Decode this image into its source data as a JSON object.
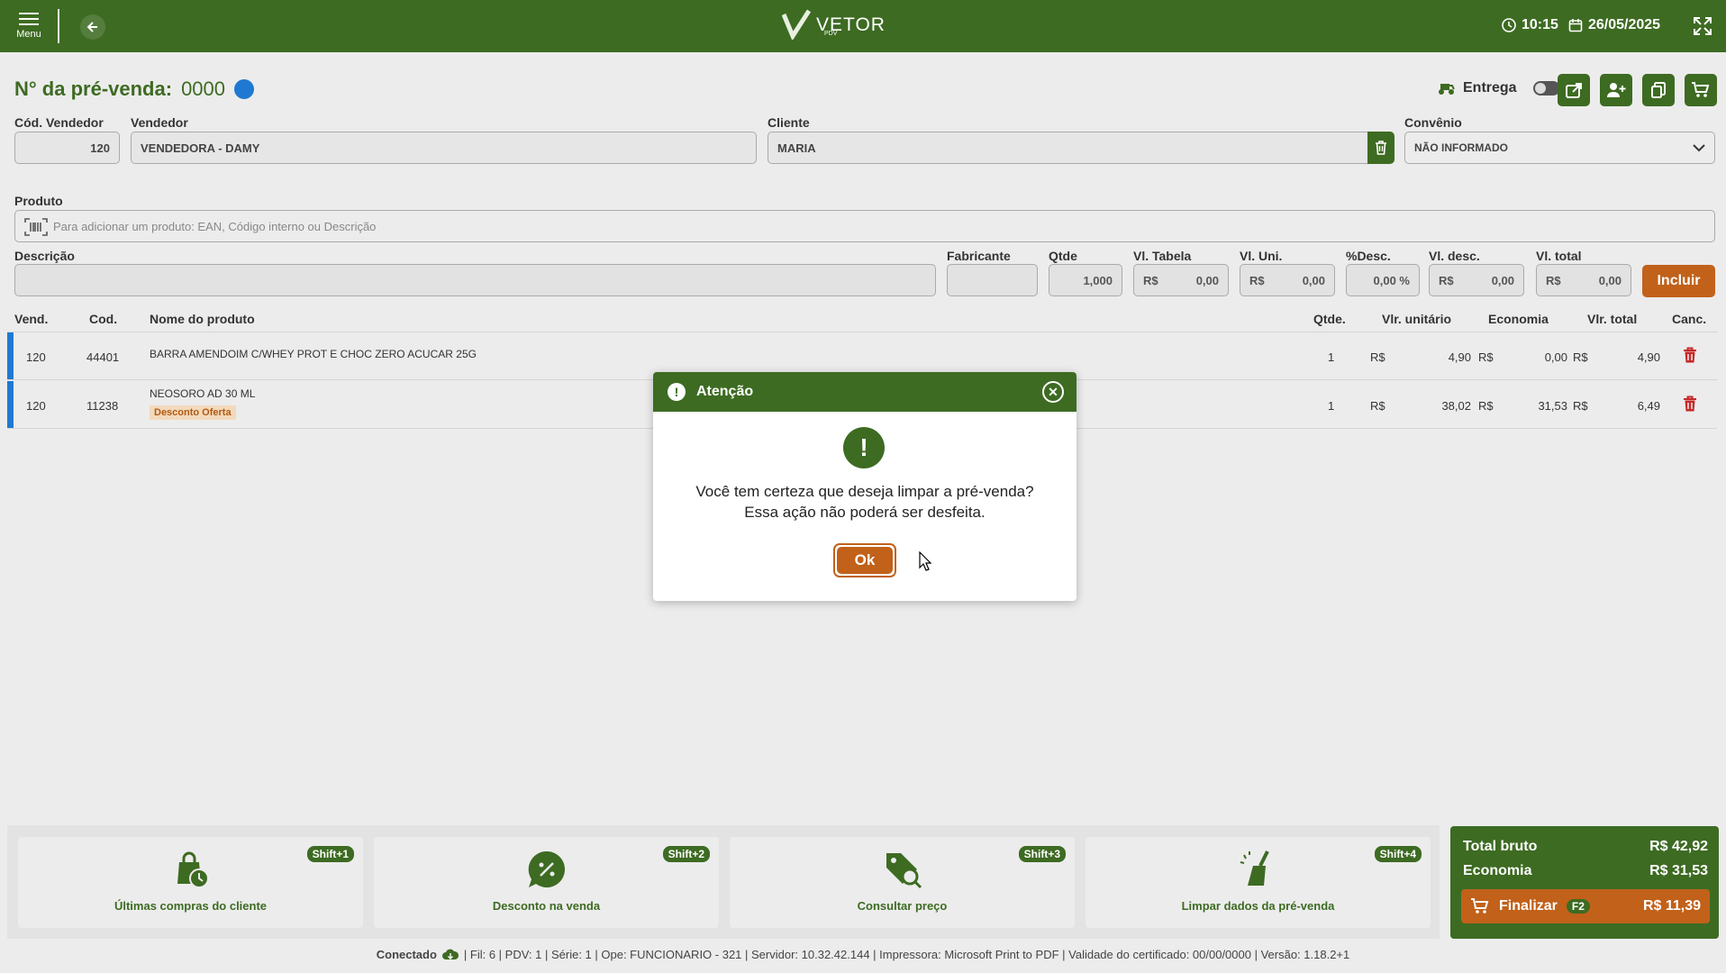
{
  "topbar": {
    "menu_label": "Menu",
    "logo_name": "VETOR",
    "logo_sub": "PDV",
    "time": "10:15",
    "date": "26/05/2025"
  },
  "header": {
    "title_label": "N° da pré-venda:",
    "title_number": "0000",
    "entrega_label": "Entrega",
    "cod_vendedor_label": "Cód. Vendedor",
    "cod_vendedor_value": "120",
    "vendedor_label": "Vendedor",
    "vendedor_value": "VENDEDORA - DAMY",
    "cliente_label": "Cliente",
    "cliente_value": "MARIA",
    "convenio_label": "Convênio",
    "convenio_value": "NÃO INFORMADO"
  },
  "entry": {
    "produto_label": "Produto",
    "produto_placeholder": "Para adicionar um produto: EAN, Código interno ou Descrição",
    "descricao_label": "Descrição",
    "fabricante_label": "Fabricante",
    "qtde_label": "Qtde",
    "qtde_value": "1,000",
    "vl_tabela_label": "Vl. Tabela",
    "vl_uni_label": "Vl. Uni.",
    "pct_desc_label": "%Desc.",
    "pct_desc_value": "0,00 %",
    "vl_desc_label": "Vl. desc.",
    "vl_total_label": "Vl. total",
    "currency": "R$",
    "zero": "0,00",
    "incluir_label": "Incluir"
  },
  "table": {
    "headers": {
      "vend": "Vend.",
      "cod": "Cod.",
      "nome": "Nome do produto",
      "qtde": "Qtde.",
      "vlr_unitario": "Vlr. unitário",
      "economia": "Economia",
      "vlr_total": "Vlr. total",
      "canc": "Canc."
    },
    "currency": "R$",
    "rows": [
      {
        "vend": "120",
        "cod": "44401",
        "nome": "BARRA AMENDOIM C/WHEY PROT E CHOC ZERO ACUCAR 25G",
        "badge": "",
        "qtde": "1",
        "vlr_unitario": "4,90",
        "economia": "0,00",
        "vlr_total": "4,90"
      },
      {
        "vend": "120",
        "cod": "11238",
        "nome": "NEOSORO AD 30 ML",
        "badge": "Desconto Oferta",
        "qtde": "1",
        "vlr_unitario": "38,02",
        "economia": "31,53",
        "vlr_total": "6,49"
      }
    ]
  },
  "dialog": {
    "title": "Atenção",
    "message_line1": "Você tem certeza que deseja limpar a pré-venda?",
    "message_line2": "Essa ação não poderá ser desfeita.",
    "ok_label": "Ok"
  },
  "actions": [
    {
      "label": "Últimas compras do cliente",
      "key": "Shift+1"
    },
    {
      "label": "Desconto na venda",
      "key": "Shift+2"
    },
    {
      "label": "Consultar preço",
      "key": "Shift+3"
    },
    {
      "label": "Limpar dados da pré-venda",
      "key": "Shift+4"
    }
  ],
  "totals": {
    "bruto_label": "Total bruto",
    "bruto_value": "R$ 42,92",
    "economia_label": "Economia",
    "economia_value": "R$ 31,53",
    "finalizar_label": "Finalizar",
    "finalizar_key": "F2",
    "finalizar_value": "R$ 11,39"
  },
  "status": {
    "conectado": "Conectado",
    "info": "| Fil: 6 | PDV: 1 | Série: 1 | Ope: FUNCIONARIO - 321 | Servidor: 10.32.42.144 | Impressora: Microsoft Print to PDF | Validade do certificado: 00/00/0000 | Versão: 1.18.2+1"
  },
  "colors": {
    "primary": "#3d6b22",
    "accent": "#c1611a",
    "blue": "#1f79d2",
    "danger": "#c62828"
  }
}
